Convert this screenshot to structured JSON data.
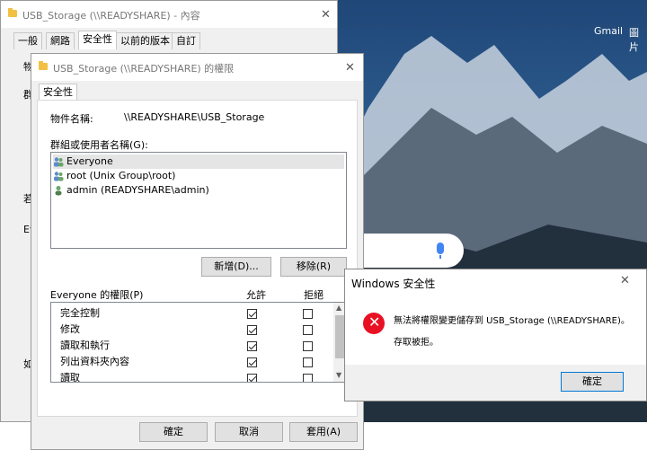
{
  "wallpaper": {
    "gmail": "Gmail",
    "images": "圖片"
  },
  "properties_window": {
    "title": "USB_Storage (\\\\READYSHARE) - 內容",
    "tabs": [
      "一般",
      "網路",
      "安全性",
      "以前的版本",
      "自訂"
    ],
    "partial_labels": [
      "物",
      "群",
      "若",
      "Everyo",
      "如"
    ]
  },
  "permissions_window": {
    "title": "USB_Storage (\\\\READYSHARE) 的權限",
    "tab": "安全性",
    "object_label": "物件名稱:",
    "object_value": "\\\\READYSHARE\\USB_Storage",
    "groups_label": "群組或使用者名稱(G):",
    "users": [
      {
        "name": "Everyone",
        "icon": "group-icon"
      },
      {
        "name": "root (Unix Group\\root)",
        "icon": "group-icon"
      },
      {
        "name": "admin (READYSHARE\\admin)",
        "icon": "user-icon"
      }
    ],
    "add_button": "新增(D)...",
    "remove_button": "移除(R)",
    "perm_header": "Everyone 的權限(P)",
    "allow_header": "允許",
    "deny_header": "拒絕",
    "permissions": [
      {
        "name": "完全控制",
        "allow": true,
        "deny": false
      },
      {
        "name": "修改",
        "allow": true,
        "deny": false
      },
      {
        "name": "讀取和執行",
        "allow": true,
        "deny": false
      },
      {
        "name": "列出資料夾內容",
        "allow": true,
        "deny": false
      },
      {
        "name": "讀取",
        "allow": true,
        "deny": false
      }
    ],
    "ok_button": "確定",
    "cancel_button": "取消",
    "apply_button": "套用(A)"
  },
  "error_dialog": {
    "title": "Windows 安全性",
    "message1": "無法將權限變更儲存到 USB_Storage (\\\\READYSHARE)。",
    "message2": "存取被拒。",
    "ok_button": "確定"
  }
}
